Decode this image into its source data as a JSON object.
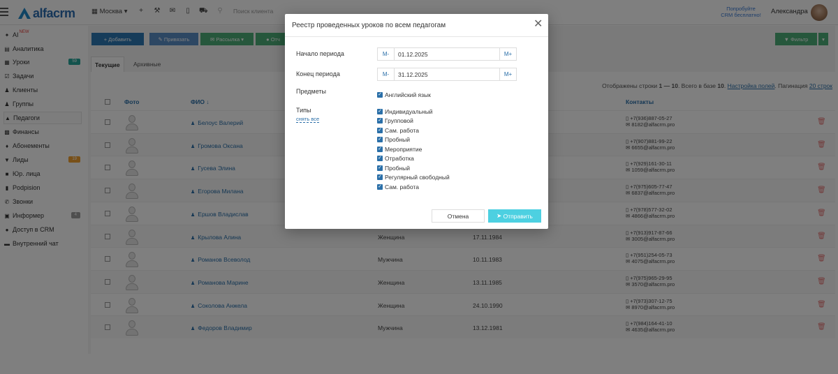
{
  "header": {
    "logo": "alfacrm",
    "city": "Москва",
    "search_placeholder": "Поиск клиента",
    "promo_line1": "Попробуйте",
    "promo_line2": "CRM бесплатно!",
    "user_name": "Александра"
  },
  "sidebar": {
    "items": [
      {
        "label": "AI",
        "badge": "NEW"
      },
      {
        "label": "Аналитика"
      },
      {
        "label": "Уроки",
        "badge": "59"
      },
      {
        "label": "Задачи"
      },
      {
        "label": "Клиенты"
      },
      {
        "label": "Группы"
      },
      {
        "label": "Педагоги"
      },
      {
        "label": "Финансы"
      },
      {
        "label": "Абонементы"
      },
      {
        "label": "Лиды",
        "badge": "19"
      },
      {
        "label": "Юр. лица"
      },
      {
        "label": "Podpision"
      },
      {
        "label": "Звонки"
      },
      {
        "label": "Информер",
        "badge": "4"
      },
      {
        "label": "Доступ в CRM"
      },
      {
        "label": "Внутренний чат"
      }
    ]
  },
  "toolbar": {
    "add": "Добавить",
    "attach": "Привязать",
    "mailing": "Рассылка",
    "report": "Отч",
    "filter": "Фильтр"
  },
  "tabs": {
    "current": "Текущие",
    "archive": "Архивные"
  },
  "summary": {
    "text1": "Отображены строки",
    "range": "1 — 10",
    "text2": ". Всего в базе",
    "total": "10",
    "fields_link": "Настройка полей",
    "pagination": "Пагинация",
    "pag_link": "20 строк"
  },
  "table": {
    "headers": {
      "photo": "Фото",
      "fio": "ФИО ↓",
      "contacts": "Контакты"
    },
    "rows": [
      {
        "fio": "Белоус Валерий",
        "gender": "",
        "bdate": "",
        "phone": "+7(936)887-05-27",
        "email": "8182@alfacrm.pro"
      },
      {
        "fio": "Громова Оксана",
        "gender": "",
        "bdate": "",
        "phone": "+7(907)881-99-22",
        "email": "6655@alfacrm.pro"
      },
      {
        "fio": "Гусева Элина",
        "gender": "",
        "bdate": "",
        "phone": "+7(929)161-30-11",
        "email": "1059@alfacrm.pro"
      },
      {
        "fio": "Егорова Милана",
        "gender": "",
        "bdate": "",
        "phone": "+7(975)605-77-47",
        "email": "6837@alfacrm.pro"
      },
      {
        "fio": "Ершов Владислав",
        "gender": "",
        "bdate": "",
        "phone": "+7(978)577-32-02",
        "email": "4866@alfacrm.pro"
      },
      {
        "fio": "Крылова Алина",
        "gender": "Женщина",
        "bdate": "17.11.1984",
        "phone": "+7(913)917-87-66",
        "email": "3005@alfacrm.pro"
      },
      {
        "fio": "Романов Всеволод",
        "gender": "Мужчина",
        "bdate": "10.11.1983",
        "phone": "+7(951)254-05-73",
        "email": "4075@alfacrm.pro"
      },
      {
        "fio": "Романова Марине",
        "gender": "Женщина",
        "bdate": "13.11.1985",
        "phone": "+7(975)965-29-95",
        "email": "3570@alfacrm.pro"
      },
      {
        "fio": "Соколова Анжела",
        "gender": "Женщина",
        "bdate": "24.10.1990",
        "phone": "+7(973)307-12-75",
        "email": "8970@alfacrm.pro"
      },
      {
        "fio": "Федоров Владимир",
        "gender": "Мужчина",
        "bdate": "13.12.1981",
        "phone": "+7(984)164-41-10",
        "email": "4635@alfacrm.pro"
      }
    ]
  },
  "modal": {
    "title": "Реестр проведенных уроков по всем педагогам",
    "start_label": "Начало периода",
    "end_label": "Конец периода",
    "minus": "M-",
    "plus": "M+",
    "start_value": "01.12.2025",
    "end_value": "31.12.2025",
    "subjects_label": "Предметы",
    "subjects": [
      "Английский язык"
    ],
    "types_label": "Типы",
    "unselect_all": "снять все",
    "types": [
      "Индивидуальный",
      "Групповой",
      "Сам. работа",
      "Пробный",
      "Мероприятие",
      "Отработка",
      "Пробный",
      "Регулярный свободный",
      "Сам. работа"
    ],
    "cancel": "Отмена",
    "submit": "Отправить"
  },
  "colors": {
    "accent": "#2a6fa8",
    "add_btn": "#2d79b5",
    "attach_btn": "#5b8fc7",
    "mailing_btn": "#4caf78",
    "submit": "#4dd0e1"
  }
}
